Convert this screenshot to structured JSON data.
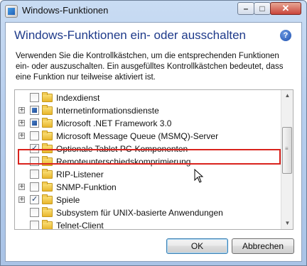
{
  "window": {
    "title": "Windows-Funktionen",
    "controls": {
      "minimize": "–",
      "maximize": "□",
      "close": "✕"
    }
  },
  "header": {
    "heading": "Windows-Funktionen ein- oder ausschalten",
    "help": "?"
  },
  "description": "Verwenden Sie die Kontrollkästchen, um die entsprechenden Funktionen ein- oder auszuschalten. Ein ausgefülltes Kontrollkästchen bedeutet, dass eine Funktion nur teilweise aktiviert ist.",
  "features": [
    {
      "label": "Indexdienst",
      "state": "unchecked",
      "expandable": false
    },
    {
      "label": "Internetinformationsdienste",
      "state": "partial",
      "expandable": true
    },
    {
      "label": "Microsoft .NET Framework 3.0",
      "state": "partial",
      "expandable": true
    },
    {
      "label": "Microsoft Message Queue (MSMQ)-Server",
      "state": "unchecked",
      "expandable": true
    },
    {
      "label": "Optionale Tablet PC-Komponenten",
      "state": "checked",
      "expandable": false
    },
    {
      "label": "Remoteunterschiedskomprimierung",
      "state": "unchecked",
      "expandable": false
    },
    {
      "label": "RIP-Listener",
      "state": "unchecked",
      "expandable": false
    },
    {
      "label": "SNMP-Funktion",
      "state": "unchecked",
      "expandable": true
    },
    {
      "label": "Spiele",
      "state": "checked",
      "expandable": true
    },
    {
      "label": "Subsystem für UNIX-basierte Anwendungen",
      "state": "unchecked",
      "expandable": false
    },
    {
      "label": "Telnet-Client",
      "state": "unchecked",
      "expandable": false
    }
  ],
  "highlight_color": "#d9231d",
  "buttons": {
    "ok": "OK",
    "cancel": "Abbrechen"
  }
}
